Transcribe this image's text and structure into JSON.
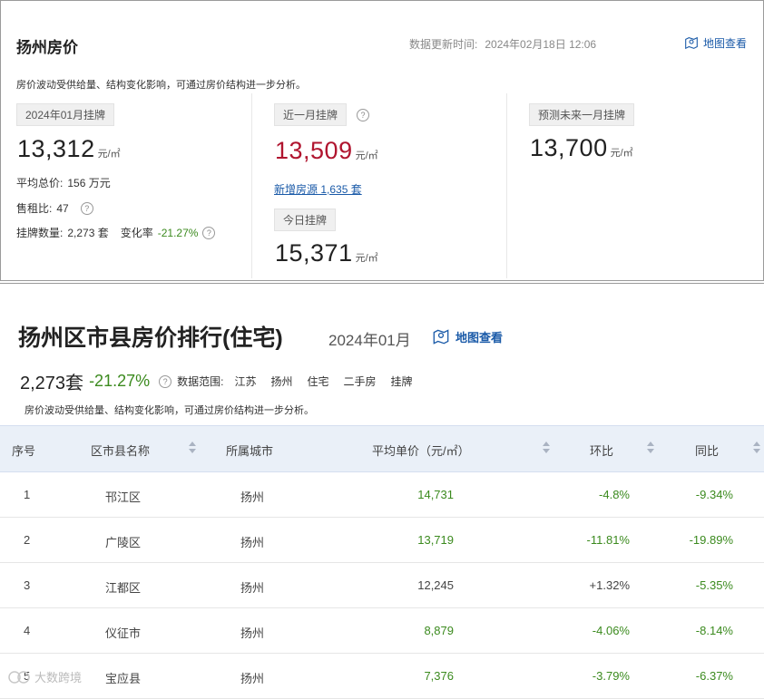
{
  "top": {
    "title": "扬州房价",
    "update_label": "数据更新时间:",
    "update_value": "2024年02月18日 12:06",
    "map_link": "地图查看",
    "description": "房价波动受供给量、结构变化影响，可通过房价结构进一步分析。",
    "col1": {
      "tag": "2024年01月挂牌",
      "price": "13,312",
      "unit": "元/㎡",
      "avg_total_label": "平均总价:",
      "avg_total_value": "156 万元",
      "rent_ratio_label": "售租比:",
      "rent_ratio_value": "47",
      "listing_label": "挂牌数量:",
      "listing_value": "2,273 套",
      "change_label": "变化率",
      "change_value": "-21.27%"
    },
    "col2": {
      "tag": "近一月挂牌",
      "price": "13,509",
      "unit": "元/㎡",
      "new_listing_link": "新增房源 1,635 套",
      "today_tag": "今日挂牌",
      "today_price": "15,371",
      "today_unit": "元/㎡"
    },
    "col3": {
      "tag": "预测未来一月挂牌",
      "price": "13,700",
      "unit": "元/㎡"
    }
  },
  "ranking": {
    "title": "扬州区市县房价排行(住宅)",
    "date": "2024年01月",
    "map_link": "地图查看",
    "count": "2,273套",
    "rate": "-21.27%",
    "scope_label": "数据范围:",
    "scope_items": [
      "江苏",
      "扬州",
      "住宅",
      "二手房",
      "挂牌"
    ],
    "description": "房价波动受供给量、结构变化影响，可通过房价结构进一步分析。",
    "headers": [
      "序号",
      "区市县名称",
      "所属城市",
      "平均单价（元/㎡）",
      "环比",
      "同比"
    ],
    "rows": [
      {
        "idx": "1",
        "name": "邗江区",
        "city": "扬州",
        "price": "14,731",
        "mom": "-4.8%",
        "yoy": "-9.34%",
        "price_red": false,
        "mom_red": false
      },
      {
        "idx": "2",
        "name": "广陵区",
        "city": "扬州",
        "price": "13,719",
        "mom": "-11.81%",
        "yoy": "-19.89%",
        "price_red": false,
        "mom_red": false
      },
      {
        "idx": "3",
        "name": "江都区",
        "city": "扬州",
        "price": "12,245",
        "mom": "+1.32%",
        "yoy": "-5.35%",
        "price_red": true,
        "mom_red": true
      },
      {
        "idx": "4",
        "name": "仪征市",
        "city": "扬州",
        "price": "8,879",
        "mom": "-4.06%",
        "yoy": "-8.14%",
        "price_red": false,
        "mom_red": false
      },
      {
        "idx": "5",
        "name": "宝应县",
        "city": "扬州",
        "price": "7,376",
        "mom": "-3.79%",
        "yoy": "-6.37%",
        "price_red": false,
        "mom_red": false
      }
    ]
  },
  "watermark": "大数跨境"
}
